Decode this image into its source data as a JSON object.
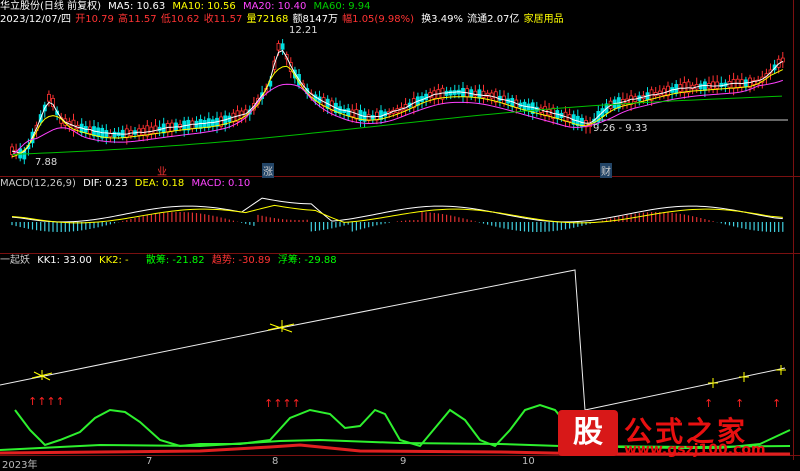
{
  "top": {
    "stock_name": "华立股份(日线 前复权)",
    "ma5": "MA5: 10.63",
    "ma10": "MA10: 10.56",
    "ma20": "MA20: 10.40",
    "ma60": "MA60: 9.94",
    "date": "2023/12/07/四",
    "open": "开10.79",
    "high": "高11.57",
    "low": "低10.62",
    "close": "收11.57",
    "volume": "量72168",
    "amount": "额8147万",
    "change": "幅1.05(9.98%)",
    "turnover": "换3.49%",
    "float": "流通2.07亿",
    "sector": "家居用品",
    "high_label": "12.21",
    "low_label": "7.88",
    "range_label": "9.26 - 9.33",
    "tag1": "业",
    "tag2": "涨",
    "tag3": "财"
  },
  "macd": {
    "title": "MACD(12,26,9)",
    "dif": "DIF: 0.23",
    "dea": "DEA: 0.18",
    "macd": "MACD: 0.10"
  },
  "ind": {
    "title": "一起妖",
    "kk1": "KK1: 33.00",
    "kk2": "KK2: -",
    "s1": "散筹: -21.82",
    "s2": "趋势: -30.89",
    "s3": "浮筹: -29.88"
  },
  "xaxis": {
    "l1": "2023年",
    "l2": "7",
    "l3": "8",
    "l4": "9",
    "l5": "10"
  },
  "watermark": {
    "logo": "股",
    "text": "公式之家",
    "url": "www.gszj100.com"
  },
  "colors": {
    "up": "#ff3232",
    "down": "#00e0e0",
    "ma5": "#ffffff",
    "ma10": "#ffff00",
    "ma20": "#ff40ff",
    "ma60": "#00c000"
  }
}
